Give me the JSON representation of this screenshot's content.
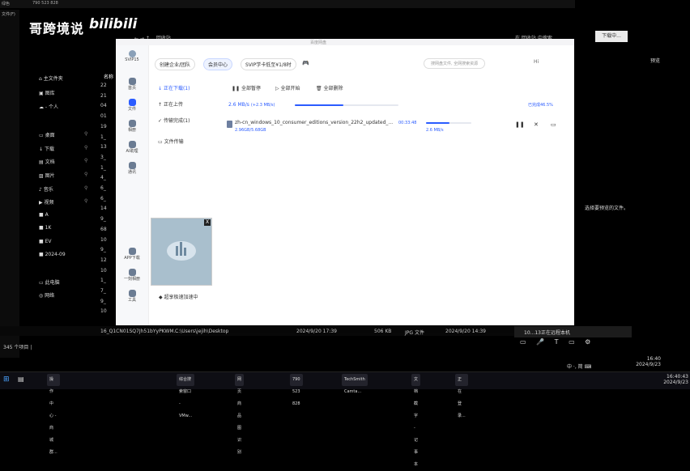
{
  "top_left": {
    "tab1": "绿色",
    "tab2": "文件(F)",
    "session_id": "790 523 828",
    "watermark": "哥跨境说",
    "watermark_brand": "bilibili"
  },
  "explorer": {
    "nav": [
      {
        "label": "主文件夹",
        "icon": "home-icon"
      },
      {
        "label": "图库",
        "icon": "gallery-icon"
      },
      {
        "label": "- 个人",
        "icon": "cloud-icon"
      },
      {
        "label": "桌面",
        "icon": "desktop-icon"
      },
      {
        "label": "下载",
        "icon": "download-icon"
      },
      {
        "label": "文档",
        "icon": "document-icon"
      },
      {
        "label": "图片",
        "icon": "picture-icon"
      },
      {
        "label": "音乐",
        "icon": "music-icon"
      },
      {
        "label": "视频",
        "icon": "video-icon"
      },
      {
        "label": "A",
        "icon": "folder-icon"
      },
      {
        "label": "1K",
        "icon": "folder-icon"
      },
      {
        "label": "EV",
        "icon": "folder-icon"
      },
      {
        "label": "2024-09",
        "icon": "folder-icon"
      },
      {
        "label": "此电脑",
        "icon": "computer-icon"
      },
      {
        "label": "网络",
        "icon": "network-icon"
      }
    ],
    "column_header": "名称",
    "files": [
      "22",
      "21",
      "04",
      "01",
      "19",
      "1_",
      "13",
      "3_",
      "1_",
      "4_",
      "6_",
      "6_",
      "14",
      "9_",
      "68",
      "10",
      "9_",
      "12",
      "10",
      "1_",
      "7_",
      "9_",
      "10"
    ],
    "status_row": {
      "name": "16_Q1CN01SQ7Jh51bYyPKWM...",
      "path": "C:\\Users\\jejih\\Desktop",
      "date1": "2024/9/20 17:39",
      "size": "506 KB",
      "type": "JPG 文件",
      "date2": "2024/9/20 14:39"
    },
    "item_count": "345 个项目 |",
    "address_right": "在 回收站 中搜索",
    "address_left": "回收站",
    "right_hint": "选择要预览的文件。",
    "preview_label": "预览"
  },
  "baidu": {
    "title": "百度网盘",
    "tabs": [
      "创建企业/团队",
      "会员中心",
      "SVIP学卡低至¥1/8时",
      "游戏"
    ],
    "search_placeholder": "搜网盘文件, 全网搜索资源",
    "user_badge": "Hi",
    "side": [
      {
        "label": "SVIP15",
        "icon": "avatar-icon"
      },
      {
        "label": "首页",
        "icon": "home-icon"
      },
      {
        "label": "文件",
        "icon": "file-icon"
      },
      {
        "label": "相册",
        "icon": "album-icon"
      },
      {
        "label": "AI助理",
        "icon": "ai-icon"
      },
      {
        "label": "通讯",
        "icon": "contacts-icon"
      },
      {
        "label": "APP下载",
        "icon": "app-download-icon"
      },
      {
        "label": "一刻相册",
        "icon": "moment-icon"
      },
      {
        "label": "工具",
        "icon": "tools-icon"
      }
    ],
    "tree": [
      {
        "label": "正在下载(1)",
        "icon": "download-icon"
      },
      {
        "label": "正在上传",
        "icon": "upload-icon"
      },
      {
        "label": "传输完成(1)",
        "icon": "check-icon"
      },
      {
        "label": "文件传输",
        "icon": "transfer-icon"
      }
    ],
    "toolbar": {
      "pause_all": "全部暂停",
      "start_all": "全部开始",
      "clear_all": "全部删除"
    },
    "speed_summary": "2.6 MB/s",
    "speed_boost": "(+2.3 MB/s)",
    "overall_status": "已完成46.5%",
    "overall_progress": 46.5,
    "task": {
      "name": "zh-cn_windows_10_consumer_editions_version_22h2_updated_...",
      "size": "2.96GB/5.68GB",
      "eta": "00:33:48",
      "speed": "2.6 MB/s",
      "progress": 52
    },
    "popup_close": "X",
    "speedup_status": "超享极速加速中"
  },
  "right_panel": {
    "button": "下载中..."
  },
  "tray": {
    "remote_status": "10...13正在远程本机",
    "ime": "中 ·, 简 ⌨",
    "time1": "16:40",
    "date1": "2024/9/23",
    "time2": "16:40:43",
    "date2": "2024/9/23"
  },
  "taskbar": {
    "apps": [
      "操作中心 - 商城群...",
      "综合搜索窗口 - VMw...",
      "网页商品图识别",
      "790 523 828",
      "TechSmith Camta...",
      "文档截字 - 记事本",
      "正在登录..."
    ]
  }
}
